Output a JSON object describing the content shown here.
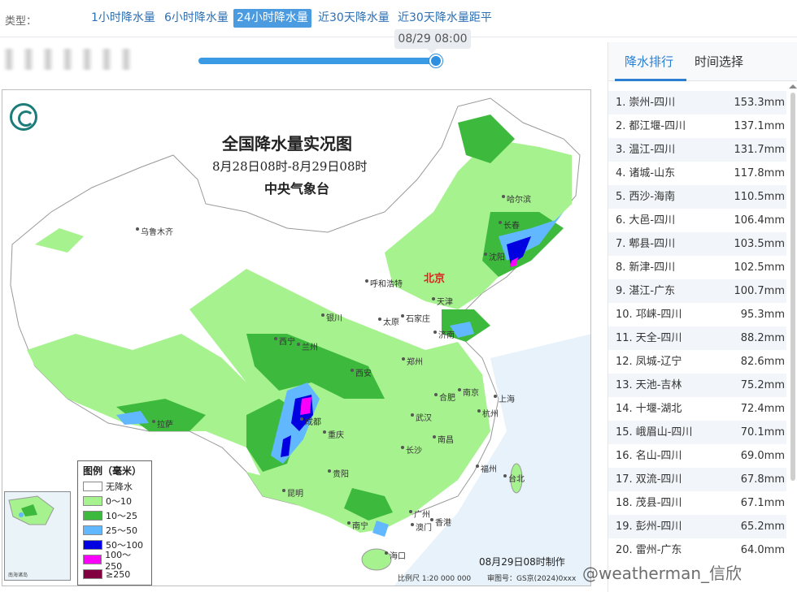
{
  "type_bar": {
    "label": "类型：",
    "tabs": [
      {
        "label": "1小时降水量"
      },
      {
        "label": "6小时降水量"
      },
      {
        "label": "24小时降水量"
      },
      {
        "label": "近30天降水量"
      },
      {
        "label": "近30天降水量距平"
      }
    ],
    "active_tab": "24小时降水量"
  },
  "time_slider": {
    "current_time": "08/29 08:00",
    "position_fraction": 1.0
  },
  "map": {
    "title": "全国降水量实况图",
    "date_range": "8月28日08时-8月29日08时",
    "org": "中央气象台",
    "capital": "北京",
    "cities": [
      "乌鲁木齐",
      "哈尔滨",
      "长春",
      "沈阳",
      "呼和浩特",
      "天津",
      "银川",
      "太原",
      "石家庄",
      "西宁",
      "兰州",
      "济南",
      "西安",
      "郑州",
      "拉萨",
      "成都",
      "合肥",
      "南京",
      "上海",
      "武汉",
      "杭州",
      "重庆",
      "长沙",
      "南昌",
      "贵阳",
      "福州",
      "昆明",
      "台北",
      "南宁",
      "广州",
      "澳门",
      "香港",
      "海口"
    ],
    "inset_label": "南海诸岛",
    "made_note": "08月29日08时制作",
    "scale_note": "比例尺 1:20 000 000",
    "review_note": "审图号：GS京(2024)0xxx",
    "legend": {
      "title": "图例（毫米）",
      "items": [
        {
          "label": "无降水",
          "color": "#ffffff"
        },
        {
          "label": "0～10",
          "color": "#a6f28f"
        },
        {
          "label": "10～25",
          "color": "#3dba3d"
        },
        {
          "label": "25～50",
          "color": "#61b8ff"
        },
        {
          "label": "50～100",
          "color": "#0000e1"
        },
        {
          "label": "100～250",
          "color": "#fa00fa"
        },
        {
          "label": "≥250",
          "color": "#800040"
        }
      ]
    }
  },
  "right_panel": {
    "tabs": [
      {
        "label": "降水排行"
      },
      {
        "label": "时间选择"
      }
    ],
    "active_tab": "降水排行",
    "ranking": [
      {
        "rank": "1.",
        "station": "崇州-四川",
        "value": "153.3mm"
      },
      {
        "rank": "2.",
        "station": "都江堰-四川",
        "value": "137.1mm"
      },
      {
        "rank": "3.",
        "station": "温江-四川",
        "value": "131.7mm"
      },
      {
        "rank": "4.",
        "station": "诸城-山东",
        "value": "117.8mm"
      },
      {
        "rank": "5.",
        "station": "西沙-海南",
        "value": "110.5mm"
      },
      {
        "rank": "6.",
        "station": "大邑-四川",
        "value": "106.4mm"
      },
      {
        "rank": "7.",
        "station": "郫县-四川",
        "value": "103.5mm"
      },
      {
        "rank": "8.",
        "station": "新津-四川",
        "value": "102.5mm"
      },
      {
        "rank": "9.",
        "station": "湛江-广东",
        "value": "100.7mm"
      },
      {
        "rank": "10.",
        "station": "邛崃-四川",
        "value": "95.3mm"
      },
      {
        "rank": "11.",
        "station": "天全-四川",
        "value": "88.2mm"
      },
      {
        "rank": "12.",
        "station": "凤城-辽宁",
        "value": "82.6mm"
      },
      {
        "rank": "13.",
        "station": "天池-吉林",
        "value": "75.2mm"
      },
      {
        "rank": "14.",
        "station": "十堰-湖北",
        "value": "72.4mm"
      },
      {
        "rank": "15.",
        "station": "峨眉山-四川",
        "value": "70.1mm"
      },
      {
        "rank": "16.",
        "station": "名山-四川",
        "value": "69.0mm"
      },
      {
        "rank": "17.",
        "station": "双流-四川",
        "value": "67.8mm"
      },
      {
        "rank": "18.",
        "station": "茂县-四川",
        "value": "67.1mm"
      },
      {
        "rank": "19.",
        "station": "彭州-四川",
        "value": "65.2mm"
      },
      {
        "rank": "20.",
        "station": "雷州-广东",
        "value": "64.0mm"
      }
    ]
  },
  "watermark": "@weatherman_信欣"
}
